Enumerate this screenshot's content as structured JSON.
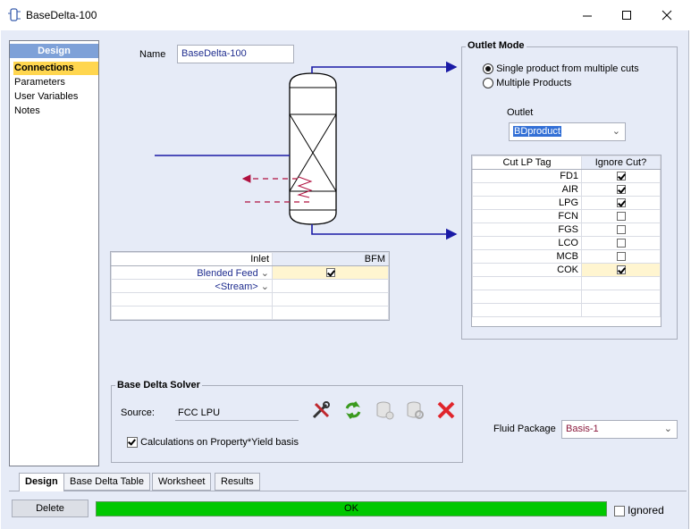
{
  "window": {
    "title": "BaseDelta-100",
    "minimize_icon": "minimize-icon",
    "maximize_icon": "maximize-icon",
    "close_icon": "close-icon"
  },
  "nav": {
    "header": "Design",
    "items": [
      {
        "label": "Connections",
        "selected": true
      },
      {
        "label": "Parameters",
        "selected": false
      },
      {
        "label": "User Variables",
        "selected": false
      },
      {
        "label": "Notes",
        "selected": false
      }
    ]
  },
  "name_field": {
    "label": "Name",
    "value": "BaseDelta-100"
  },
  "inlet_table": {
    "headers": [
      "Inlet",
      "BFM"
    ],
    "rows": [
      {
        "stream": "Blended Feed",
        "checked": true
      },
      {
        "stream": "<Stream>",
        "checked": false
      }
    ]
  },
  "outlet_mode": {
    "title": "Outlet Mode",
    "options": [
      {
        "label": "Single product from multiple cuts",
        "selected": true
      },
      {
        "label": "Multiple Products",
        "selected": false
      }
    ],
    "outlet_label": "Outlet",
    "outlet_value": "BDproduct",
    "cuts_headers": [
      "Cut LP Tag",
      "Ignore Cut?"
    ],
    "cuts": [
      {
        "tag": "FD1",
        "ignore": true
      },
      {
        "tag": "AIR",
        "ignore": true
      },
      {
        "tag": "LPG",
        "ignore": true
      },
      {
        "tag": "FCN",
        "ignore": false
      },
      {
        "tag": "FGS",
        "ignore": false
      },
      {
        "tag": "LCO",
        "ignore": false
      },
      {
        "tag": "MCB",
        "ignore": false
      },
      {
        "tag": "COK",
        "ignore": true
      }
    ]
  },
  "solver": {
    "title": "Base Delta Solver",
    "source_label": "Source:",
    "source_value": "FCC LPU",
    "calc_label": "Calculations on Property*Yield basis",
    "calc_checked": true,
    "tools": [
      "tools-icon",
      "refresh-icon",
      "database-icon",
      "database-settings-icon",
      "delete-icon"
    ]
  },
  "fluid_package": {
    "label": "Fluid Package",
    "value": "Basis-1"
  },
  "tabs": [
    {
      "label": "Design",
      "active": true
    },
    {
      "label": "Base Delta Table",
      "active": false
    },
    {
      "label": "Worksheet",
      "active": false
    },
    {
      "label": "Results",
      "active": false
    }
  ],
  "footer": {
    "delete_label": "Delete",
    "status": "OK",
    "status_color": "#00c800",
    "ignored_label": "Ignored",
    "ignored_checked": false
  }
}
